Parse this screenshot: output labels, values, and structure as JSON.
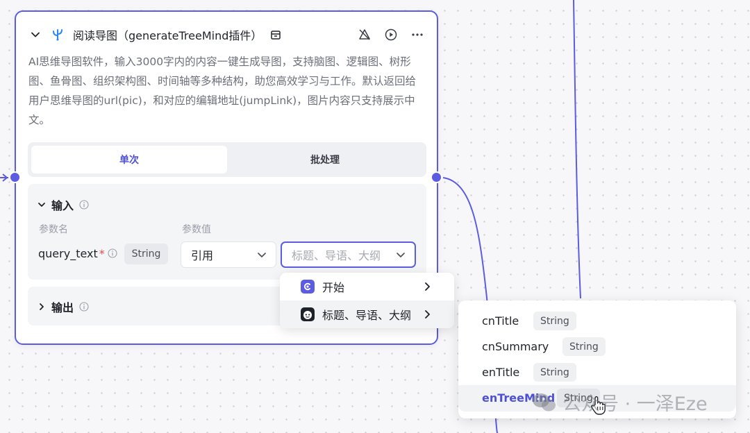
{
  "node": {
    "title": "阅读导图（generateTreeMind插件）",
    "description": "AI思维导图软件，输入3000字内的内容一键生成导图，支持脑图、逻辑图、树形图、鱼骨图、组织架构图、时间轴等多种结构，助您高效学习与工作。默认返回给用户思维导图的url(pic)，和对应的编辑地址(jumpLink)，图片内容只支持展示中文。",
    "tabs": [
      {
        "label": "单次",
        "active": true
      },
      {
        "label": "批处理",
        "active": false
      }
    ],
    "input_section": {
      "title": "输入",
      "col_param_name": "参数名",
      "col_param_value": "参数值",
      "param": {
        "name": "query_text",
        "required_mark": "*",
        "type": "String",
        "source_value": "引用",
        "variable_placeholder": "标题、导语、大纲"
      }
    },
    "output_section": {
      "title": "输出"
    }
  },
  "menu": {
    "items": [
      {
        "label": "开始"
      },
      {
        "label": "标题、导语、大纲"
      }
    ]
  },
  "submenu": {
    "items": [
      {
        "name": "cnTitle",
        "type": "String"
      },
      {
        "name": "cnSummary",
        "type": "String"
      },
      {
        "name": "enTitle",
        "type": "String"
      },
      {
        "name": "enTreeMind",
        "type": "String"
      }
    ]
  },
  "watermark": {
    "text": "公众号 · 一泽Eze"
  },
  "colors": {
    "accent": "#5b5ce2",
    "required": "#e5484d",
    "text": "#1f2329",
    "muted": "#6b6f7a"
  },
  "icons": {
    "collapse": "chevron-down-icon",
    "plugin": "plugin-icon",
    "store": "store-icon",
    "debug_off": "bug-off-icon",
    "run": "play-circle-icon",
    "more": "more-icon",
    "info": "info-icon"
  }
}
